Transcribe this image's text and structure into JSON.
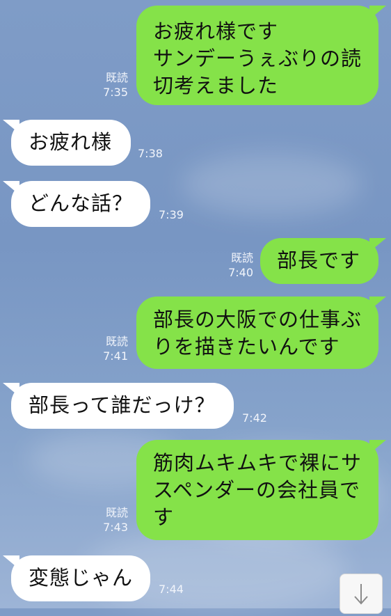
{
  "messages": [
    {
      "dir": "out",
      "text": "お疲れ様です\nサンデーうぇぶりの読\n切考えました",
      "read": "既読",
      "time": "7:35"
    },
    {
      "dir": "in",
      "text": "お疲れ様",
      "time": "7:38"
    },
    {
      "dir": "in",
      "text": "どんな話？",
      "time": "7:39"
    },
    {
      "dir": "out",
      "text": "部長です",
      "read": "既読",
      "time": "7:40"
    },
    {
      "dir": "out",
      "text": "部長の大阪での仕事ぶ\nりを描きたいんです",
      "read": "既読",
      "time": "7:41"
    },
    {
      "dir": "in",
      "text": "部長って誰だっけ？",
      "time": "7:42"
    },
    {
      "dir": "out",
      "text": "筋肉ムキムキで裸にサ\nスペンダーの会社員で\nす",
      "read": "既読",
      "time": "7:43"
    },
    {
      "dir": "in",
      "text": "変態じゃん",
      "time": "7:44"
    }
  ],
  "scroll_button": {
    "icon": "arrow-down-icon"
  }
}
